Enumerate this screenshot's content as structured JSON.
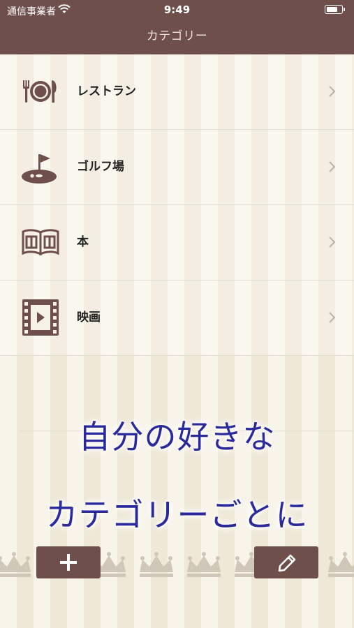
{
  "status_bar": {
    "carrier": "通信事業者",
    "time": "9:49"
  },
  "nav": {
    "title": "カテゴリー"
  },
  "categories": [
    {
      "label": "レストラン",
      "icon": "restaurant-icon"
    },
    {
      "label": "ゴルフ場",
      "icon": "golf-icon"
    },
    {
      "label": "本",
      "icon": "book-icon"
    },
    {
      "label": "映画",
      "icon": "film-icon"
    }
  ],
  "caption": {
    "line1": "自分の好きな",
    "line2": "カテゴリーごとに"
  },
  "toolbar": {
    "add_icon": "plus-icon",
    "edit_icon": "pencil-icon"
  },
  "colors": {
    "brand": "#6e4f4b",
    "caption": "#2b2a9c"
  }
}
